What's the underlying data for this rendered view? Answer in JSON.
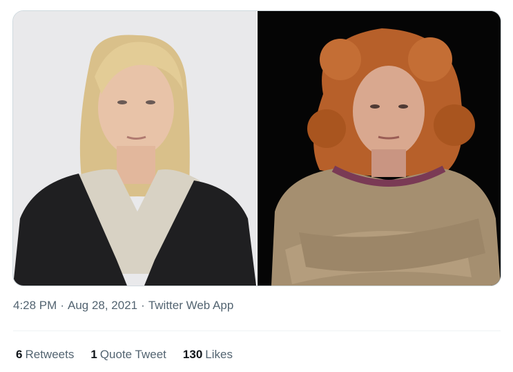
{
  "tweet": {
    "timestamp_time": "4:28 PM",
    "timestamp_date": "Aug 28, 2021",
    "source": "Twitter Web App",
    "separator": "·",
    "stats": {
      "retweets_count": "6",
      "retweets_label": "Retweets",
      "quotes_count": "1",
      "quotes_label": "Quote Tweet",
      "likes_count": "130",
      "likes_label": "Likes"
    }
  },
  "colors": {
    "text_primary": "#0f1419",
    "text_secondary": "#536471",
    "divider": "#eff3f4",
    "media_border": "#cfd9de"
  }
}
